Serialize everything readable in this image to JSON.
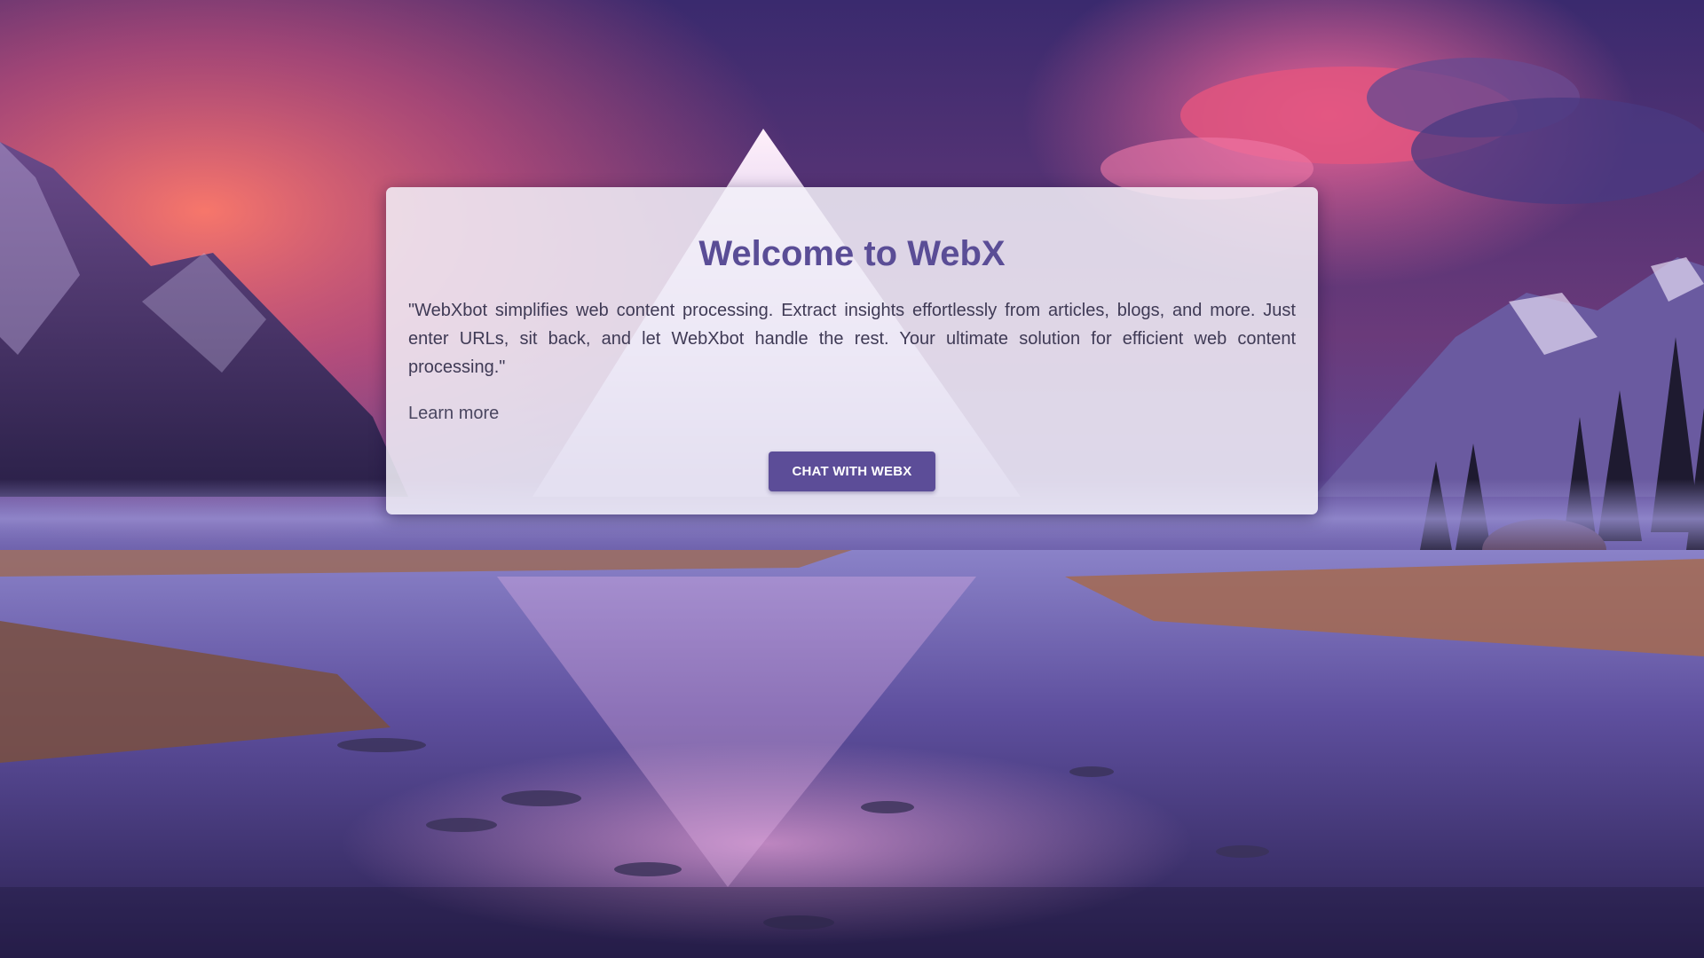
{
  "welcome": {
    "title": "Welcome to WebX",
    "description": "\"WebXbot simplifies web content processing. Extract insights effortlessly from articles, blogs, and more. Just enter URLs, sit back, and let WebXbot handle the rest. Your ultimate solution for efficient web content processing.\"",
    "learn_more": "Learn more",
    "cta_label": "CHAT WITH WEBX"
  },
  "colors": {
    "accent": "#5c4d98",
    "title": "#5a4d96",
    "card_background": "#f2f0f8"
  }
}
